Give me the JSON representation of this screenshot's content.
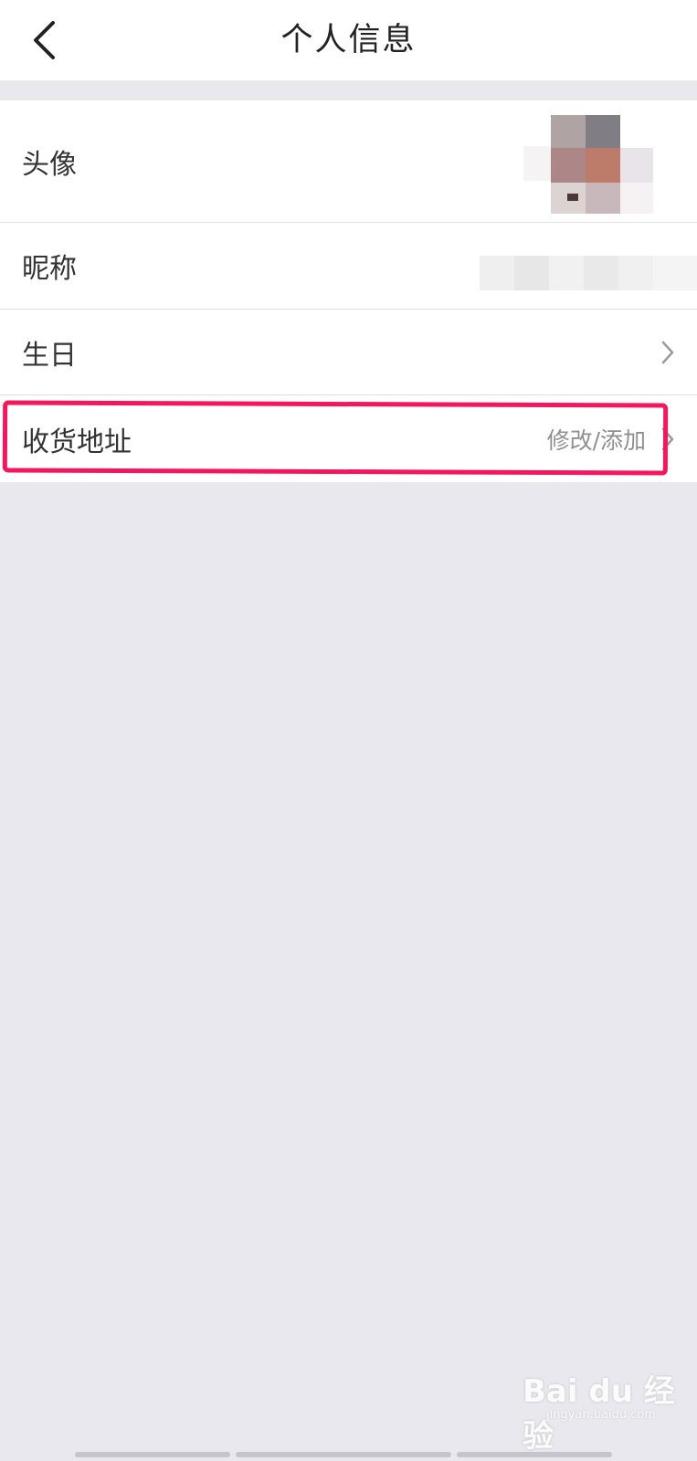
{
  "header": {
    "title": "个人信息",
    "back_icon": "chevron-left-icon"
  },
  "rows": [
    {
      "label": "头像",
      "value": "",
      "icon": "avatar-image"
    },
    {
      "label": "昵称",
      "value": ""
    },
    {
      "label": "生日",
      "value": "",
      "icon": "chevron-right-icon"
    },
    {
      "label": "收货地址",
      "value": "修改/添加",
      "icon": "chevron-right-icon"
    }
  ],
  "annotation": {
    "highlight_color": "#f4175d"
  },
  "watermark": {
    "logo_text": "Bai du 经验",
    "sub_text": "jingyan.baidu.com"
  },
  "colors": {
    "background": "#e9e8ee",
    "row_background": "#ffffff",
    "label": "#333333",
    "value": "#8f8f8f"
  }
}
